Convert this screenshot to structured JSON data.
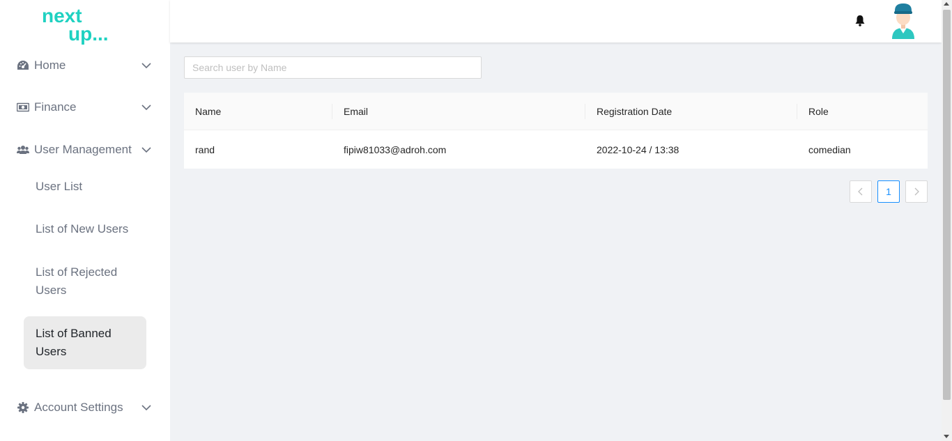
{
  "app": {
    "brand_colors": {
      "logo": "#1fd1c1",
      "accent": "#1890ff"
    }
  },
  "sidebar": {
    "items": [
      {
        "label": "Home",
        "icon": "dashboard-icon"
      },
      {
        "label": "Finance",
        "icon": "money-icon"
      },
      {
        "label": "User Management",
        "icon": "users-icon",
        "children": [
          {
            "label": "User List"
          },
          {
            "label": "List of New Users"
          },
          {
            "label": "List of Rejected Users"
          },
          {
            "label": "List of Banned Users",
            "active": true
          }
        ]
      },
      {
        "label": "Account Settings",
        "icon": "gear-icon"
      }
    ]
  },
  "header": {
    "notification_icon": "bell-icon",
    "avatar_icon": "user-avatar-icon"
  },
  "search": {
    "placeholder": "Search user by Name",
    "value": ""
  },
  "table": {
    "columns": [
      "Name",
      "Email",
      "Registration Date",
      "Role"
    ],
    "rows": [
      {
        "name": "rand",
        "email": "fipiw81033@adroh.com",
        "registration_date": "2022-10-24 / 13:38",
        "role": "comedian"
      }
    ]
  },
  "pagination": {
    "current_page": "1",
    "prev_icon": "chevron-left-icon",
    "next_icon": "chevron-right-icon"
  }
}
